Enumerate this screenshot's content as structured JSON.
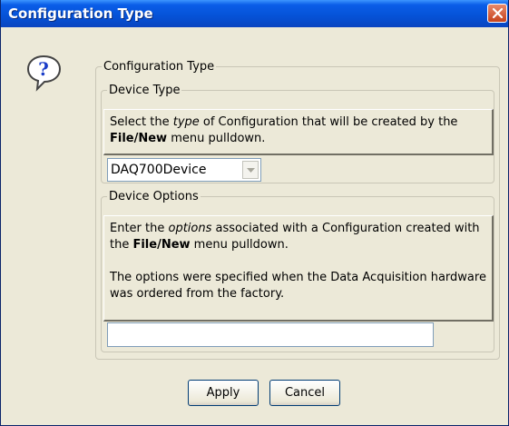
{
  "window": {
    "title": "Configuration Type",
    "close_icon": "close-icon"
  },
  "icon": "question-icon",
  "outer_group": {
    "label": "Configuration Type"
  },
  "device_type": {
    "label": "Device Type",
    "desc_1": "Select the ",
    "desc_em": "type",
    "desc_2": " of Configuration that will be created by the ",
    "desc_bold": "File/New",
    "desc_3": " menu pulldown.",
    "selected": "DAQ700Device"
  },
  "device_options": {
    "label": "Device Options",
    "desc_1": "Enter the ",
    "desc_em": "options",
    "desc_2": " associated with a Configuration created with the ",
    "desc_bold": "File/New",
    "desc_3": " menu pulldown.",
    "desc_p2": "The options were specified when the Data Acquisition hardware was ordered from the factory.",
    "value": ""
  },
  "buttons": {
    "apply": "Apply",
    "cancel": "Cancel"
  }
}
